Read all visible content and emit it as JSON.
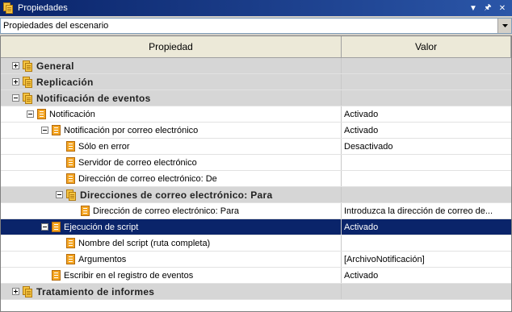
{
  "window": {
    "title": "Propiedades"
  },
  "combo": {
    "value": "Propiedades del escenario"
  },
  "header": {
    "property": "Propiedad",
    "value": "Valor"
  },
  "rows": [
    {
      "kind": "cat",
      "level": 0,
      "expander": "plus",
      "label": "General",
      "value": ""
    },
    {
      "kind": "cat",
      "level": 0,
      "expander": "plus",
      "label": "Replicación",
      "value": ""
    },
    {
      "kind": "cat",
      "level": 0,
      "expander": "minus",
      "label": "Notificación de eventos",
      "value": ""
    },
    {
      "kind": "prop",
      "level": 1,
      "expander": "minus",
      "label": "Notificación",
      "value": "Activado"
    },
    {
      "kind": "prop",
      "level": 2,
      "expander": "minus",
      "label": "Notificación por correo electrónico",
      "value": "Activado"
    },
    {
      "kind": "prop",
      "level": 3,
      "expander": "none",
      "label": "Sólo en error",
      "value": "Desactivado"
    },
    {
      "kind": "prop",
      "level": 3,
      "expander": "none",
      "label": "Servidor de correo electrónico",
      "value": ""
    },
    {
      "kind": "prop",
      "level": 3,
      "expander": "none",
      "label": "Dirección de correo electrónico: De",
      "value": ""
    },
    {
      "kind": "cat",
      "level": 3,
      "expander": "minus",
      "label": "Direcciones de correo electrónico: Para",
      "value": ""
    },
    {
      "kind": "prop",
      "level": 4,
      "expander": "none",
      "label": "Dirección de correo electrónico: Para",
      "value": "Introduzca la dirección de correo de..."
    },
    {
      "kind": "prop",
      "level": 2,
      "expander": "minus",
      "label": "Ejecución de script",
      "value": "Activado",
      "selected": true
    },
    {
      "kind": "prop",
      "level": 3,
      "expander": "none",
      "label": "Nombre del script (ruta completa)",
      "value": ""
    },
    {
      "kind": "prop",
      "level": 3,
      "expander": "none",
      "label": "Argumentos",
      "value": "[ArchivoNotificación]"
    },
    {
      "kind": "prop",
      "level": 2,
      "expander": "none",
      "label": "Escribir en el registro de eventos",
      "value": "Activado"
    },
    {
      "kind": "cat",
      "level": 0,
      "expander": "plus",
      "label": "Tratamiento de informes",
      "value": ""
    }
  ]
}
